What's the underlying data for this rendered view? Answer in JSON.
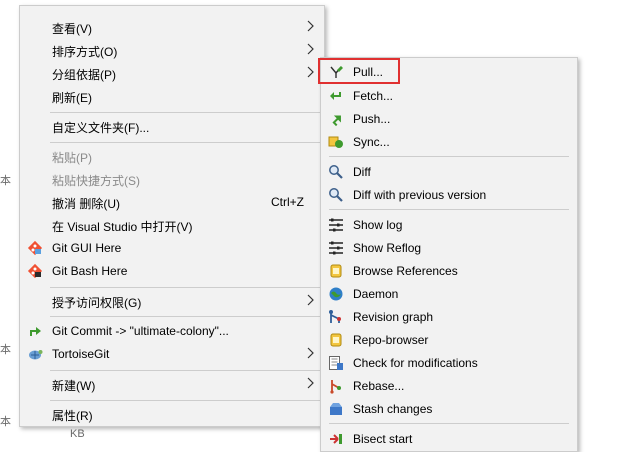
{
  "background_fragments": [
    "本",
    "本",
    "本",
    "KB"
  ],
  "context_menu": {
    "items": [
      {
        "label": "查看(V)"
      },
      {
        "label": "排序方式(O)"
      },
      {
        "label": "分组依据(P)"
      },
      {
        "label": "刷新(E)"
      },
      {
        "label": "自定义文件夹(F)..."
      },
      {
        "label": "粘贴(P)"
      },
      {
        "label": "粘贴快捷方式(S)"
      },
      {
        "label": "撤消 删除(U)",
        "shortcut": "Ctrl+Z"
      },
      {
        "label": "在 Visual Studio 中打开(V)"
      },
      {
        "label": "Git GUI Here",
        "icon": "git-gui-icon"
      },
      {
        "label": "Git Bash Here",
        "icon": "git-bash-icon"
      },
      {
        "label": "授予访问权限(G)"
      },
      {
        "label": "Git Commit -> \"ultimate-colony\"...",
        "icon": "git-commit-icon"
      },
      {
        "label": "TortoiseGit",
        "icon": "tortoisegit-icon"
      },
      {
        "label": "新建(W)"
      },
      {
        "label": "属性(R)"
      }
    ]
  },
  "tortoisegit_submenu": {
    "items": [
      {
        "label": "Pull...",
        "icon": "pull-icon"
      },
      {
        "label": "Fetch...",
        "icon": "fetch-icon"
      },
      {
        "label": "Push...",
        "icon": "push-icon"
      },
      {
        "label": "Sync...",
        "icon": "sync-icon"
      },
      {
        "label": "Diff",
        "icon": "diff-icon"
      },
      {
        "label": "Diff with previous version",
        "icon": "diff-previous-icon"
      },
      {
        "label": "Show log",
        "icon": "show-log-icon"
      },
      {
        "label": "Show Reflog",
        "icon": "show-reflog-icon"
      },
      {
        "label": "Browse References",
        "icon": "browse-references-icon"
      },
      {
        "label": "Daemon",
        "icon": "daemon-icon"
      },
      {
        "label": "Revision graph",
        "icon": "revision-graph-icon"
      },
      {
        "label": "Repo-browser",
        "icon": "repo-browser-icon"
      },
      {
        "label": "Check for modifications",
        "icon": "check-modifications-icon"
      },
      {
        "label": "Rebase...",
        "icon": "rebase-icon"
      },
      {
        "label": "Stash changes",
        "icon": "stash-icon"
      },
      {
        "label": "Bisect start",
        "icon": "bisect-icon"
      }
    ]
  },
  "colors": {
    "menu_bg": "#f2f2f2",
    "separator": "#cdcdcd",
    "disabled_text": "#8a8a8a",
    "highlight_border": "#e03030"
  }
}
